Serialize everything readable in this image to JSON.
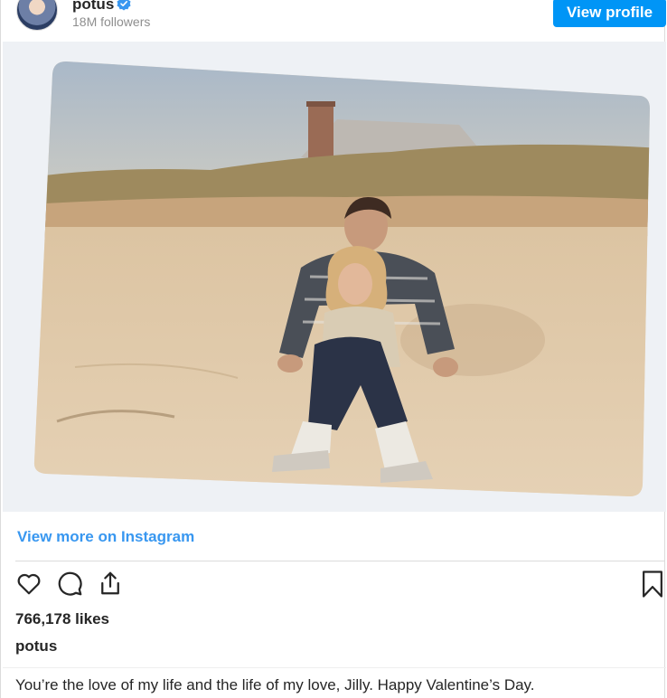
{
  "header": {
    "username": "potus",
    "followers": "18M followers",
    "view_profile_label": "View profile"
  },
  "post": {
    "view_more_label": "View more on Instagram",
    "likes": "766,178 likes",
    "caption_username": "potus",
    "caption_text": "You’re the love of my life and the life of my love, Jilly. Happy Valentine’s Day."
  },
  "icons": {
    "verified": "verified-badge-icon",
    "like": "heart-icon",
    "comment": "comment-bubble-icon",
    "share": "share-icon",
    "save": "bookmark-icon"
  },
  "colors": {
    "accent": "#0095f6",
    "link": "#3897f0",
    "text": "#262626",
    "muted": "#8e8e8e",
    "border": "#dbdbdb"
  }
}
